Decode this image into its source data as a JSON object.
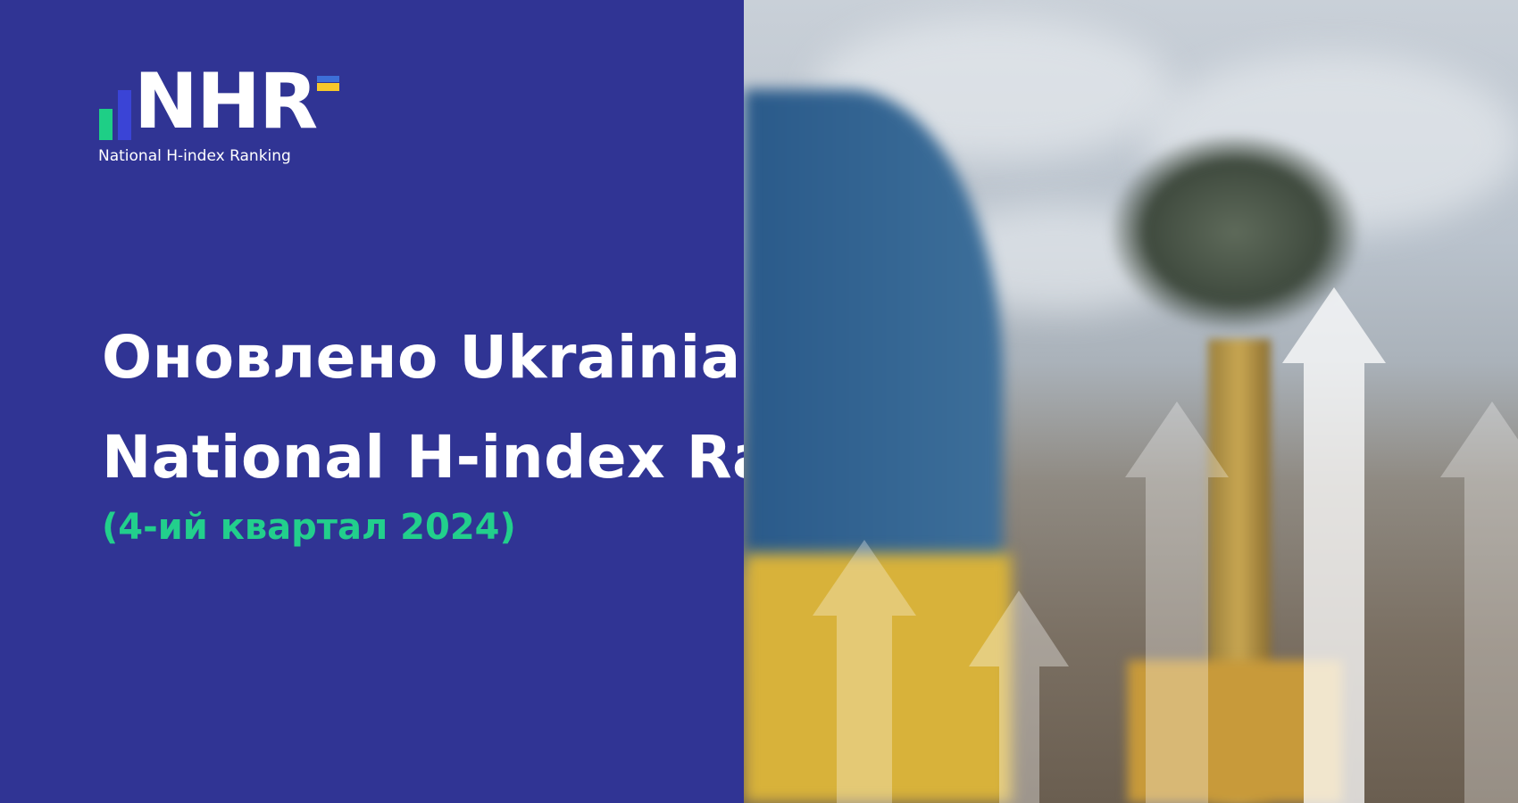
{
  "logo": {
    "mark": "NHR",
    "tagline": "National H-index Ranking"
  },
  "headline": {
    "line1": "Оновлено Ukrainian",
    "line2": "National H-index Ranking"
  },
  "subtitle": "(4-ий квартал 2024)",
  "colors": {
    "background": "#303494",
    "accent_green": "#22cf8c",
    "flag_blue": "#3d6fd8",
    "flag_yellow": "#f6c82b",
    "text": "#ffffff"
  }
}
